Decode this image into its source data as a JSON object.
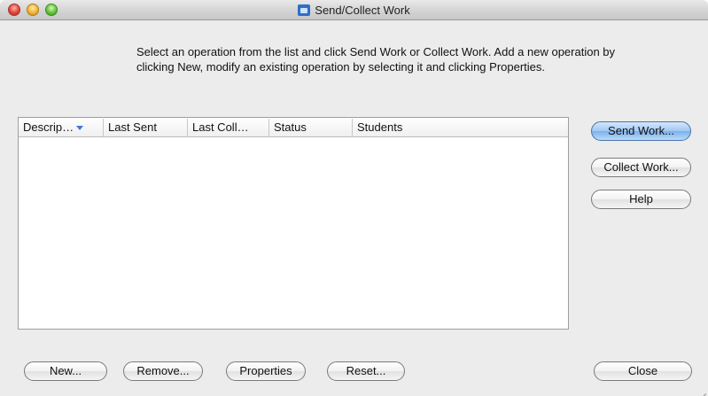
{
  "window": {
    "title": "Send/Collect Work"
  },
  "instructions": {
    "line1": "Select an operation from the list and click Send Work or Collect Work. Add a new operation by",
    "line2": "clicking New, modify an existing operation by selecting it and clicking Properties."
  },
  "table": {
    "columns": [
      "Descrip…",
      "Last Sent",
      "Last Coll…",
      "Status",
      "Students"
    ],
    "sort_column": "Descrip…",
    "sort_direction": "descending",
    "rows": []
  },
  "side_buttons": {
    "send_work": "Send Work...",
    "collect_work": "Collect Work...",
    "help": "Help"
  },
  "bottom_buttons": {
    "new": "New...",
    "remove": "Remove...",
    "properties": "Properties",
    "reset": "Reset...",
    "close": "Close"
  },
  "colors": {
    "default_button": "#7cb1ec",
    "sort_arrow": "#3c7ad6",
    "window_bg": "#ececec"
  }
}
